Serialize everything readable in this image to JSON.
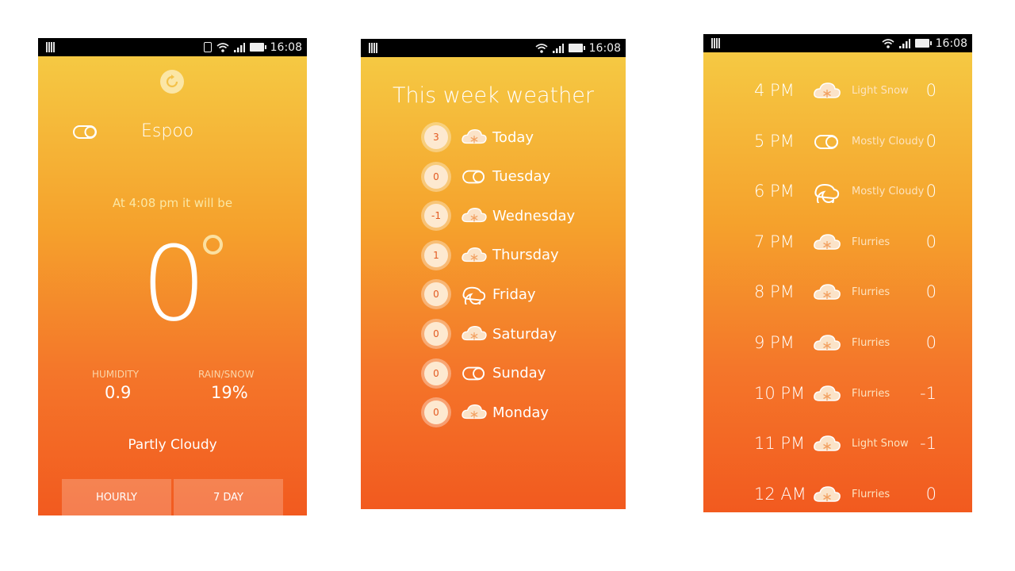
{
  "status_bar": {
    "time": "16:08"
  },
  "current": {
    "city": "Espoo",
    "subtitle": "At 4:08 pm it will be",
    "temperature": "0",
    "humidity_label": "HUMIDITY",
    "humidity_value": "0.9",
    "rain_label": "RAIN/SNOW",
    "rain_value": "19%",
    "condition": "Partly Cloudy",
    "hourly_button": "HOURLY",
    "seven_day_button": "7 DAY",
    "icons": {
      "refresh": "refresh-icon",
      "city": "partly-cloudy-icon"
    }
  },
  "week": {
    "title": "This week weather",
    "days": [
      {
        "temp": "3",
        "name": "Today",
        "icon": "snow-cloud-icon"
      },
      {
        "temp": "0",
        "name": "Tuesday",
        "icon": "partly-cloudy-icon"
      },
      {
        "temp": "-1",
        "name": "Wednesday",
        "icon": "snow-cloud-icon"
      },
      {
        "temp": "1",
        "name": "Thursday",
        "icon": "snow-cloud-icon"
      },
      {
        "temp": "0",
        "name": "Friday",
        "icon": "cloudy-night-icon"
      },
      {
        "temp": "0",
        "name": "Saturday",
        "icon": "snow-cloud-icon"
      },
      {
        "temp": "0",
        "name": "Sunday",
        "icon": "partly-cloudy-icon"
      },
      {
        "temp": "0",
        "name": "Monday",
        "icon": "snow-cloud-icon"
      }
    ]
  },
  "hourly": [
    {
      "time": "4 PM",
      "condition": "Light Snow",
      "temp": "0",
      "icon": "snow-cloud-icon"
    },
    {
      "time": "5 PM",
      "condition": "Mostly Cloudy",
      "temp": "0",
      "icon": "partly-cloudy-icon"
    },
    {
      "time": "6 PM",
      "condition": "Mostly Cloudy",
      "temp": "0",
      "icon": "cloudy-night-icon"
    },
    {
      "time": "7 PM",
      "condition": "Flurries",
      "temp": "0",
      "icon": "snow-cloud-icon"
    },
    {
      "time": "8 PM",
      "condition": "Flurries",
      "temp": "0",
      "icon": "snow-cloud-icon"
    },
    {
      "time": "9 PM",
      "condition": "Flurries",
      "temp": "0",
      "icon": "snow-cloud-icon"
    },
    {
      "time": "10 PM",
      "condition": "Flurries",
      "temp": "-1",
      "icon": "snow-cloud-icon"
    },
    {
      "time": "11 PM",
      "condition": "Light Snow",
      "temp": "-1",
      "icon": "snow-cloud-icon"
    },
    {
      "time": "12 AM",
      "condition": "Flurries",
      "temp": "0",
      "icon": "snow-cloud-icon"
    }
  ],
  "colors": {
    "gradient_top": "#f5cd45",
    "gradient_bottom": "#f25a1f",
    "badge_text": "#e35a20"
  }
}
